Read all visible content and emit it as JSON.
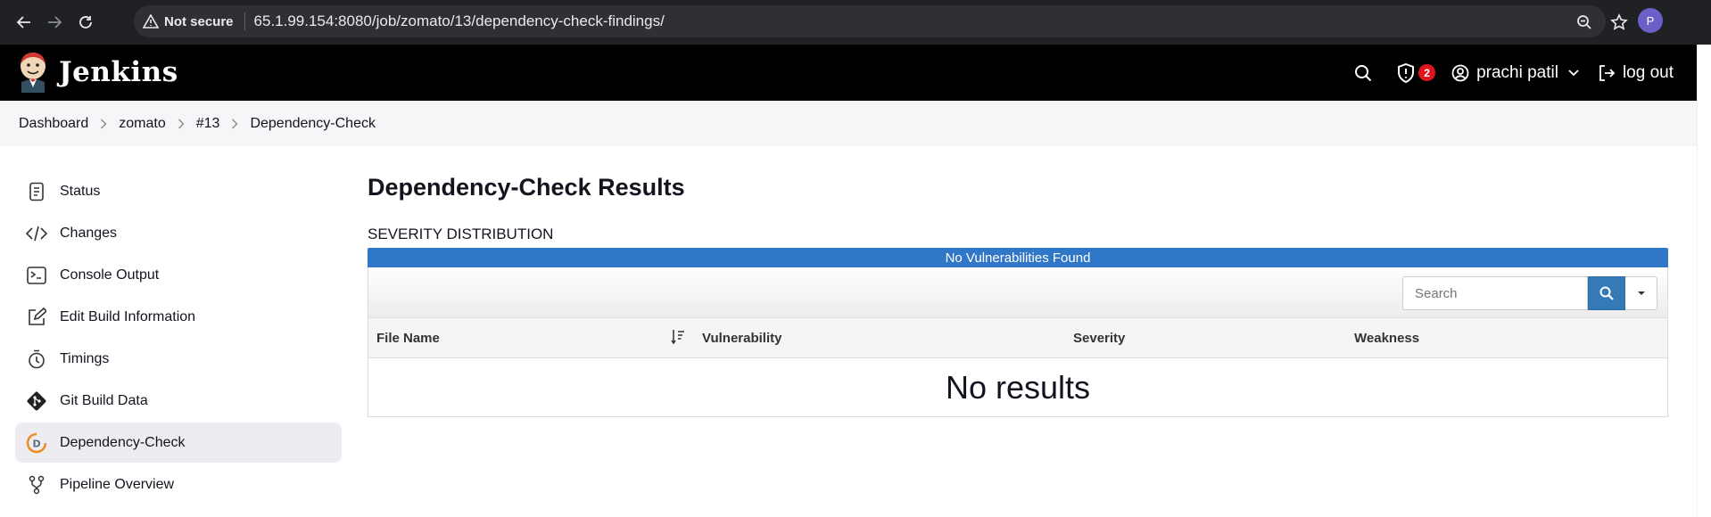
{
  "browser": {
    "security_label": "Not secure",
    "url": "65.1.99.154:8080/job/zomato/13/dependency-check-findings/",
    "profile_initial": "P"
  },
  "header": {
    "brand": "Jenkins",
    "alerts_count": "2",
    "user_name": "prachi patil",
    "logout_label": "log out"
  },
  "breadcrumbs": [
    "Dashboard",
    "zomato",
    "#13",
    "Dependency-Check"
  ],
  "sidebar": {
    "items": [
      {
        "label": "Status",
        "icon": "notepad-icon"
      },
      {
        "label": "Changes",
        "icon": "code-icon"
      },
      {
        "label": "Console Output",
        "icon": "terminal-icon"
      },
      {
        "label": "Edit Build Information",
        "icon": "edit-icon"
      },
      {
        "label": "Timings",
        "icon": "stopwatch-icon"
      },
      {
        "label": "Git Build Data",
        "icon": "git-icon"
      },
      {
        "label": "Dependency-Check",
        "icon": "dependency-check-icon",
        "active": true
      },
      {
        "label": "Pipeline Overview",
        "icon": "pipeline-icon"
      }
    ]
  },
  "main": {
    "title": "Dependency-Check Results",
    "severity_title": "SEVERITY DISTRIBUTION",
    "severity_bar_text": "No Vulnerabilities Found",
    "search_placeholder": "Search",
    "columns": [
      "File Name",
      "Vulnerability",
      "Severity",
      "Weakness"
    ],
    "empty_text": "No results"
  },
  "colors": {
    "header_bg": "#000000",
    "severity_bar": "#3177c7",
    "search_button": "#337ab7",
    "alert_badge": "#e0141e"
  }
}
